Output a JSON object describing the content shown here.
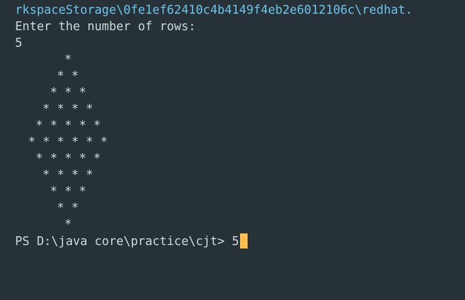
{
  "terminal": {
    "path_text": "rkspaceStorage\\0fe1ef62410c4b4149f4eb2e6012106c\\redhat.",
    "prompt_text": "Enter the number of rows:",
    "input_value": "5",
    "pattern_rows": [
      "*",
      "* *",
      "* * *",
      "* * * *",
      "* * * * *",
      "* * * * * *",
      "* * * * *",
      "* * * *",
      "* * *",
      "* *",
      "*"
    ],
    "ps_prompt": "PS D:\\java core\\practice\\cjt> ",
    "ps_input": "5",
    "colors": {
      "background": "#263238",
      "text": "#cfd8dc",
      "path": "#6ec4e8",
      "cursor": "#ffc04d"
    }
  }
}
